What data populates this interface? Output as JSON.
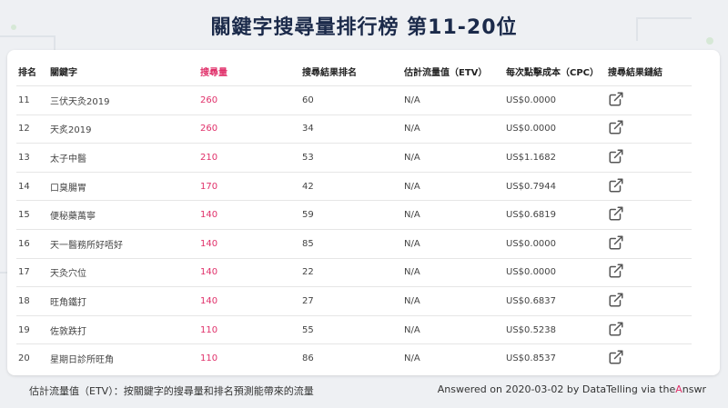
{
  "title": "關鍵字搜尋量排行榜 第11-20位",
  "table": {
    "headers": {
      "rank": "排名",
      "keyword": "關鍵字",
      "volume": "搜尋量",
      "serp_rank": "搜尋結果排名",
      "etv": "估計流量值（ETV）",
      "cpc": "每次點擊成本（CPC）",
      "link": "搜尋結果鏈結"
    },
    "rows": [
      {
        "rank": "11",
        "keyword": "三伏天灸2019",
        "volume": "260",
        "serp_rank": "60",
        "etv": "N/A",
        "cpc": "US$0.0000"
      },
      {
        "rank": "12",
        "keyword": "天炙2019",
        "volume": "260",
        "serp_rank": "34",
        "etv": "N/A",
        "cpc": "US$0.0000"
      },
      {
        "rank": "13",
        "keyword": "太子中醫",
        "volume": "210",
        "serp_rank": "53",
        "etv": "N/A",
        "cpc": "US$1.1682"
      },
      {
        "rank": "14",
        "keyword": "口臭腸胃",
        "volume": "170",
        "serp_rank": "42",
        "etv": "N/A",
        "cpc": "US$0.7944"
      },
      {
        "rank": "15",
        "keyword": "便秘藥萬寧",
        "volume": "140",
        "serp_rank": "59",
        "etv": "N/A",
        "cpc": "US$0.6819"
      },
      {
        "rank": "16",
        "keyword": "天一醫務所好唔好",
        "volume": "140",
        "serp_rank": "85",
        "etv": "N/A",
        "cpc": "US$0.0000"
      },
      {
        "rank": "17",
        "keyword": "天灸穴位",
        "volume": "140",
        "serp_rank": "22",
        "etv": "N/A",
        "cpc": "US$0.0000"
      },
      {
        "rank": "18",
        "keyword": "旺角鐵打",
        "volume": "140",
        "serp_rank": "27",
        "etv": "N/A",
        "cpc": "US$0.6837"
      },
      {
        "rank": "19",
        "keyword": "佐敦跌打",
        "volume": "110",
        "serp_rank": "55",
        "etv": "N/A",
        "cpc": "US$0.5238"
      },
      {
        "rank": "20",
        "keyword": "星期日診所旺角",
        "volume": "110",
        "serp_rank": "86",
        "etv": "N/A",
        "cpc": "US$0.8537"
      }
    ]
  },
  "footer": {
    "note": "估計流量值（ETV）：按關鍵字的搜尋量和排名預測能帶來的流量",
    "credit_prefix": "Answered on 2020-03-02 by DataTelling via the",
    "credit_accent": "A",
    "credit_suffix": "nswr"
  },
  "colors": {
    "accent": "#e0306a",
    "title": "#1b2a4a"
  },
  "icons": {
    "link": "external-link-icon"
  }
}
